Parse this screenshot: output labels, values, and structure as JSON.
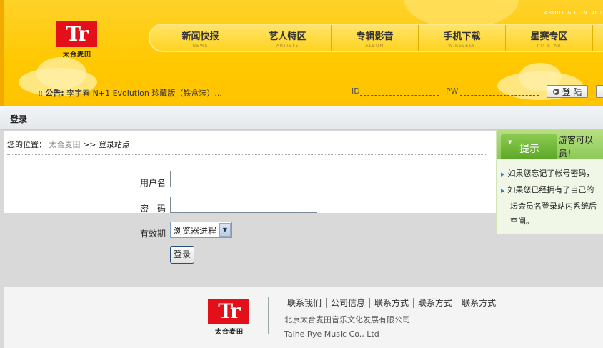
{
  "header": {
    "top_link": "ABOUT & CONTACT",
    "logo": {
      "mark": "Tr",
      "name": "太合麦田"
    },
    "nav": [
      {
        "cn": "新闻快报",
        "en": "NEWS"
      },
      {
        "cn": "艺人特区",
        "en": "ARTISTS"
      },
      {
        "cn": "专辑影音",
        "en": "ALBUM"
      },
      {
        "cn": "手机下载",
        "en": "WIRELESS"
      },
      {
        "cn": "星赛专区",
        "en": "I'M STAR"
      }
    ],
    "notice_label": "公告:",
    "notice_text": "李宇春  N+1 Evolution 珍藏版（铁盒装）...",
    "login": {
      "id_label": "ID",
      "pw_label": "PW",
      "button_label": "登 陆"
    }
  },
  "page_title": "登录",
  "breadcrumb": {
    "prefix": "您的位置：",
    "home": "太合麦田",
    "sep": ">>",
    "current": "登录站点"
  },
  "form": {
    "username_label": "用户名",
    "password_label": "密　码",
    "expiry_label": "有效期",
    "expiry_selected": "浏览器进程",
    "submit_label": "登录"
  },
  "tip": {
    "tab_label": "提示",
    "guest_text": "游客可以员！",
    "items": [
      "如果您忘记了帐号密码，",
      "如果您已经拥有了自己的"
    ],
    "item2_continuation": [
      "坛会员名登录站内系统后",
      "空间。"
    ]
  },
  "footer": {
    "logo": {
      "mark": "Tr",
      "name": "太合麦田"
    },
    "links": [
      "联系我们",
      "公司信息",
      "联系方式",
      "联系方式",
      "联系方式"
    ],
    "company_cn": "北京太合麦田音乐文化发展有限公司",
    "company_en": "Taihe Rye Music Co., Ltd"
  }
}
